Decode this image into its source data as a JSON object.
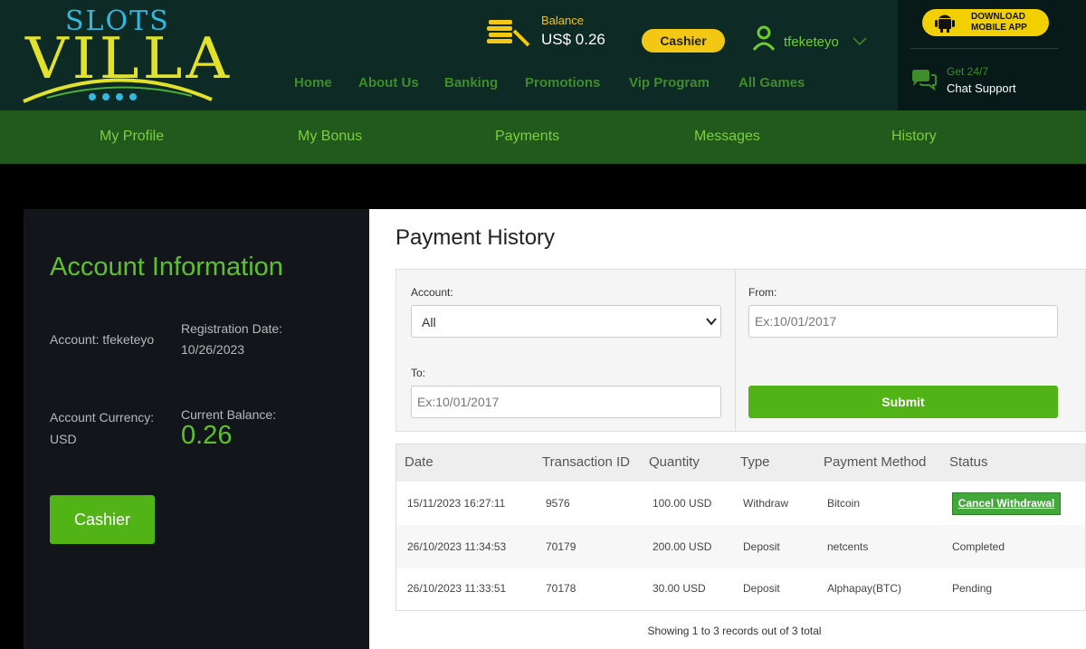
{
  "brand": {
    "logo_line1": "SLOTS",
    "logo_line2": "VILLA"
  },
  "balance": {
    "label": "Balance",
    "value": "US$ 0.26"
  },
  "header_cashier_label": "Cashier",
  "user": {
    "name": "tfeketeyo"
  },
  "main_nav": [
    "Home",
    "About Us",
    "Banking",
    "Promotions",
    "Vip Program",
    "All Games"
  ],
  "download": {
    "line1": "DOWNLOAD",
    "line2": "MOBILE APP"
  },
  "support": {
    "line1": "Get 24/7",
    "line2": "Chat Support"
  },
  "sub_nav": [
    "My Profile",
    "My Bonus",
    "Payments",
    "Messages",
    "History"
  ],
  "account_info": {
    "title": "Account Information",
    "account_label": "Account: tfeketeyo",
    "registration_label": "Registration Date:",
    "registration_value": "10/26/2023",
    "currency_label": "Account Currency:",
    "currency_value": "USD",
    "current_balance_label": "Current Balance:",
    "current_balance_value": "0.26",
    "cashier_button": "Cashier"
  },
  "payment_history": {
    "title": "Payment History",
    "account_label": "Account:",
    "account_selected": "All",
    "from_label": "From:",
    "from_placeholder": "Ex:10/01/2017",
    "to_label": "To:",
    "to_placeholder": "Ex:10/01/2017",
    "submit_label": "Submit",
    "columns": [
      "Date",
      "Transaction ID",
      "Quantity",
      "Type",
      "Payment Method",
      "Status"
    ],
    "rows": [
      {
        "date": "15/11/2023 16:27:11",
        "id": "9576",
        "qty": "100.00 USD",
        "type": "Withdraw",
        "method": "Bitcoin",
        "status": "Cancel Withdrawal"
      },
      {
        "date": "26/10/2023 11:34:53",
        "id": "70179",
        "qty": "200.00 USD",
        "type": "Deposit",
        "method": "netcents",
        "status": "Completed"
      },
      {
        "date": "26/10/2023 11:33:51",
        "id": "70178",
        "qty": "30.00 USD",
        "type": "Deposit",
        "method": "Alphapay(BTC)",
        "status": "Pending"
      }
    ],
    "footer": "Showing 1 to 3 records out of 3 total"
  },
  "colors": {
    "header_bg": "#0d2a25",
    "subnav_bg": "#22591c",
    "accent_green": "#52b317",
    "gold": "#f2c814"
  },
  "icons": [
    "coins-icon",
    "user-icon",
    "chevron-down-icon",
    "android-icon",
    "chat-icon"
  ]
}
